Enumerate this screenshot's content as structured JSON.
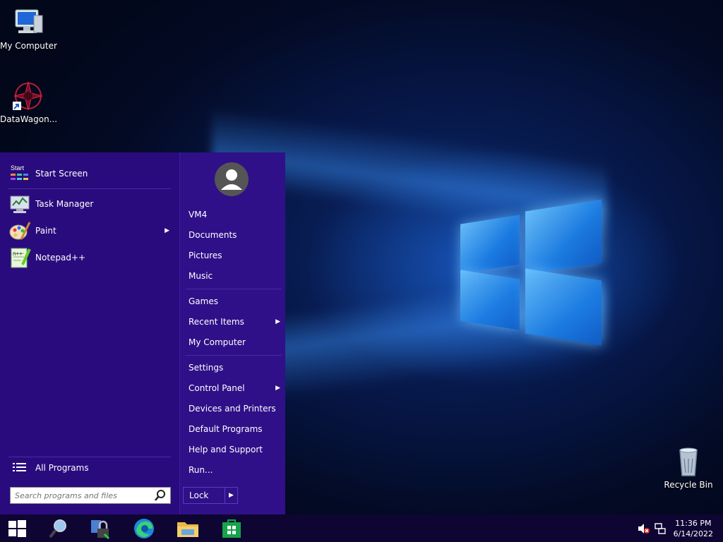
{
  "desktop": {
    "icons": [
      {
        "label": "My Computer",
        "icon": "computer-icon"
      },
      {
        "label": "DataWagon...",
        "icon": "datawagon-icon"
      },
      {
        "label": "Recycle Bin",
        "icon": "recycle-bin-icon"
      }
    ]
  },
  "start_menu": {
    "left": {
      "items": [
        {
          "label": "Start Screen",
          "icon": "start-screen-icon",
          "badge": "Start"
        },
        {
          "label": "Task Manager",
          "icon": "task-manager-icon"
        },
        {
          "label": "Paint",
          "icon": "paint-icon",
          "submenu_arrow": "▶"
        },
        {
          "label": "Notepad++",
          "icon": "notepad-plus-plus-icon"
        }
      ],
      "all_programs": {
        "label": "All Programs",
        "icon": "list-icon"
      },
      "search": {
        "placeholder": "Search programs and files",
        "icon": "search-icon"
      }
    },
    "right": {
      "user_avatar": "user-avatar-icon",
      "items": [
        {
          "label": "VM4"
        },
        {
          "label": "Documents"
        },
        {
          "label": "Pictures"
        },
        {
          "label": "Music"
        },
        {
          "label": "Games"
        },
        {
          "label": "Recent Items",
          "submenu_arrow": "▶"
        },
        {
          "label": "My Computer"
        },
        {
          "label": "Settings"
        },
        {
          "label": "Control Panel",
          "submenu_arrow": "▶"
        },
        {
          "label": "Devices and Printers"
        },
        {
          "label": "Default Programs"
        },
        {
          "label": "Help and Support"
        },
        {
          "label": "Run..."
        }
      ],
      "lock_button": {
        "label": "Lock",
        "arrow": "▶"
      }
    }
  },
  "taskbar": {
    "buttons": [
      {
        "name": "windows-start-icon"
      },
      {
        "name": "magnifier-icon"
      },
      {
        "name": "lock-app-icon"
      },
      {
        "name": "edge-browser-icon"
      },
      {
        "name": "file-explorer-icon"
      },
      {
        "name": "store-icon"
      }
    ],
    "tray": {
      "time": "11:36 PM",
      "date": "6/14/2022",
      "icons": [
        "volume-muted-icon",
        "network-icon"
      ]
    }
  },
  "colors": {
    "start_menu_bg": "#2d0e82",
    "taskbar_bg": "#0e0533",
    "accent": "#1c7fe6"
  }
}
